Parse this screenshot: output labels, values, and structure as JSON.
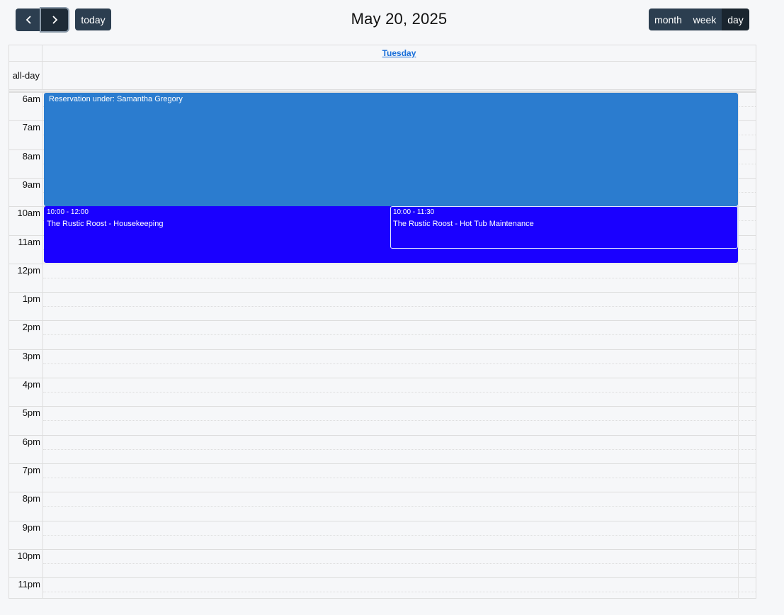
{
  "toolbar": {
    "prev_icon": "chevron-left-icon",
    "next_icon": "chevron-right-icon",
    "today_label": "today",
    "title": "May 20, 2025",
    "views": [
      "month",
      "week",
      "day"
    ],
    "active_view": "day"
  },
  "calendar": {
    "day_header": "Tuesday",
    "allday_label": "all-day",
    "time_slots": [
      "6am",
      "7am",
      "8am",
      "9am",
      "10am",
      "11am",
      "12pm",
      "1pm",
      "2pm",
      "3pm",
      "4pm",
      "5pm",
      "6pm",
      "7pm",
      "8pm",
      "9pm",
      "10pm",
      "11pm"
    ],
    "events": [
      {
        "id": "reservation",
        "time": "",
        "title": "Reservation under: Samantha Gregory",
        "color": "#2b7ccf"
      },
      {
        "id": "housekeeping",
        "time": "10:00 - 12:00",
        "title": "The Rustic Roost - Housekeeping",
        "color": "#1a00ff"
      },
      {
        "id": "hot-tub",
        "time": "10:00 - 11:30",
        "title": "The Rustic Roost - Hot Tub Maintenance",
        "color": "#1a00ff"
      }
    ]
  }
}
